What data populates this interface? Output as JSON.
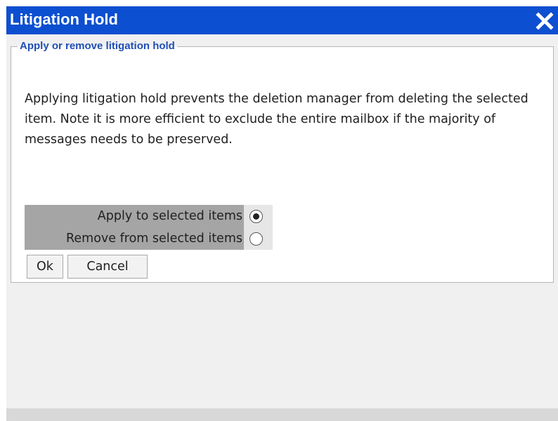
{
  "dialog": {
    "title": "Litigation Hold",
    "close_icon": "close-icon"
  },
  "group": {
    "legend": "Apply or remove litigation hold",
    "description": "Applying litigation hold prevents the deletion manager from deleting the selected item. Note it is more efficient to exclude the entire mailbox if the majority of messages needs to be preserved."
  },
  "options": [
    {
      "label": "Apply to selected items",
      "selected": true
    },
    {
      "label": "Remove from selected items",
      "selected": false
    }
  ],
  "buttons": {
    "ok": "Ok",
    "cancel": "Cancel"
  },
  "colors": {
    "titlebar": "#0c4fd0",
    "legend": "#1f4fb5"
  }
}
